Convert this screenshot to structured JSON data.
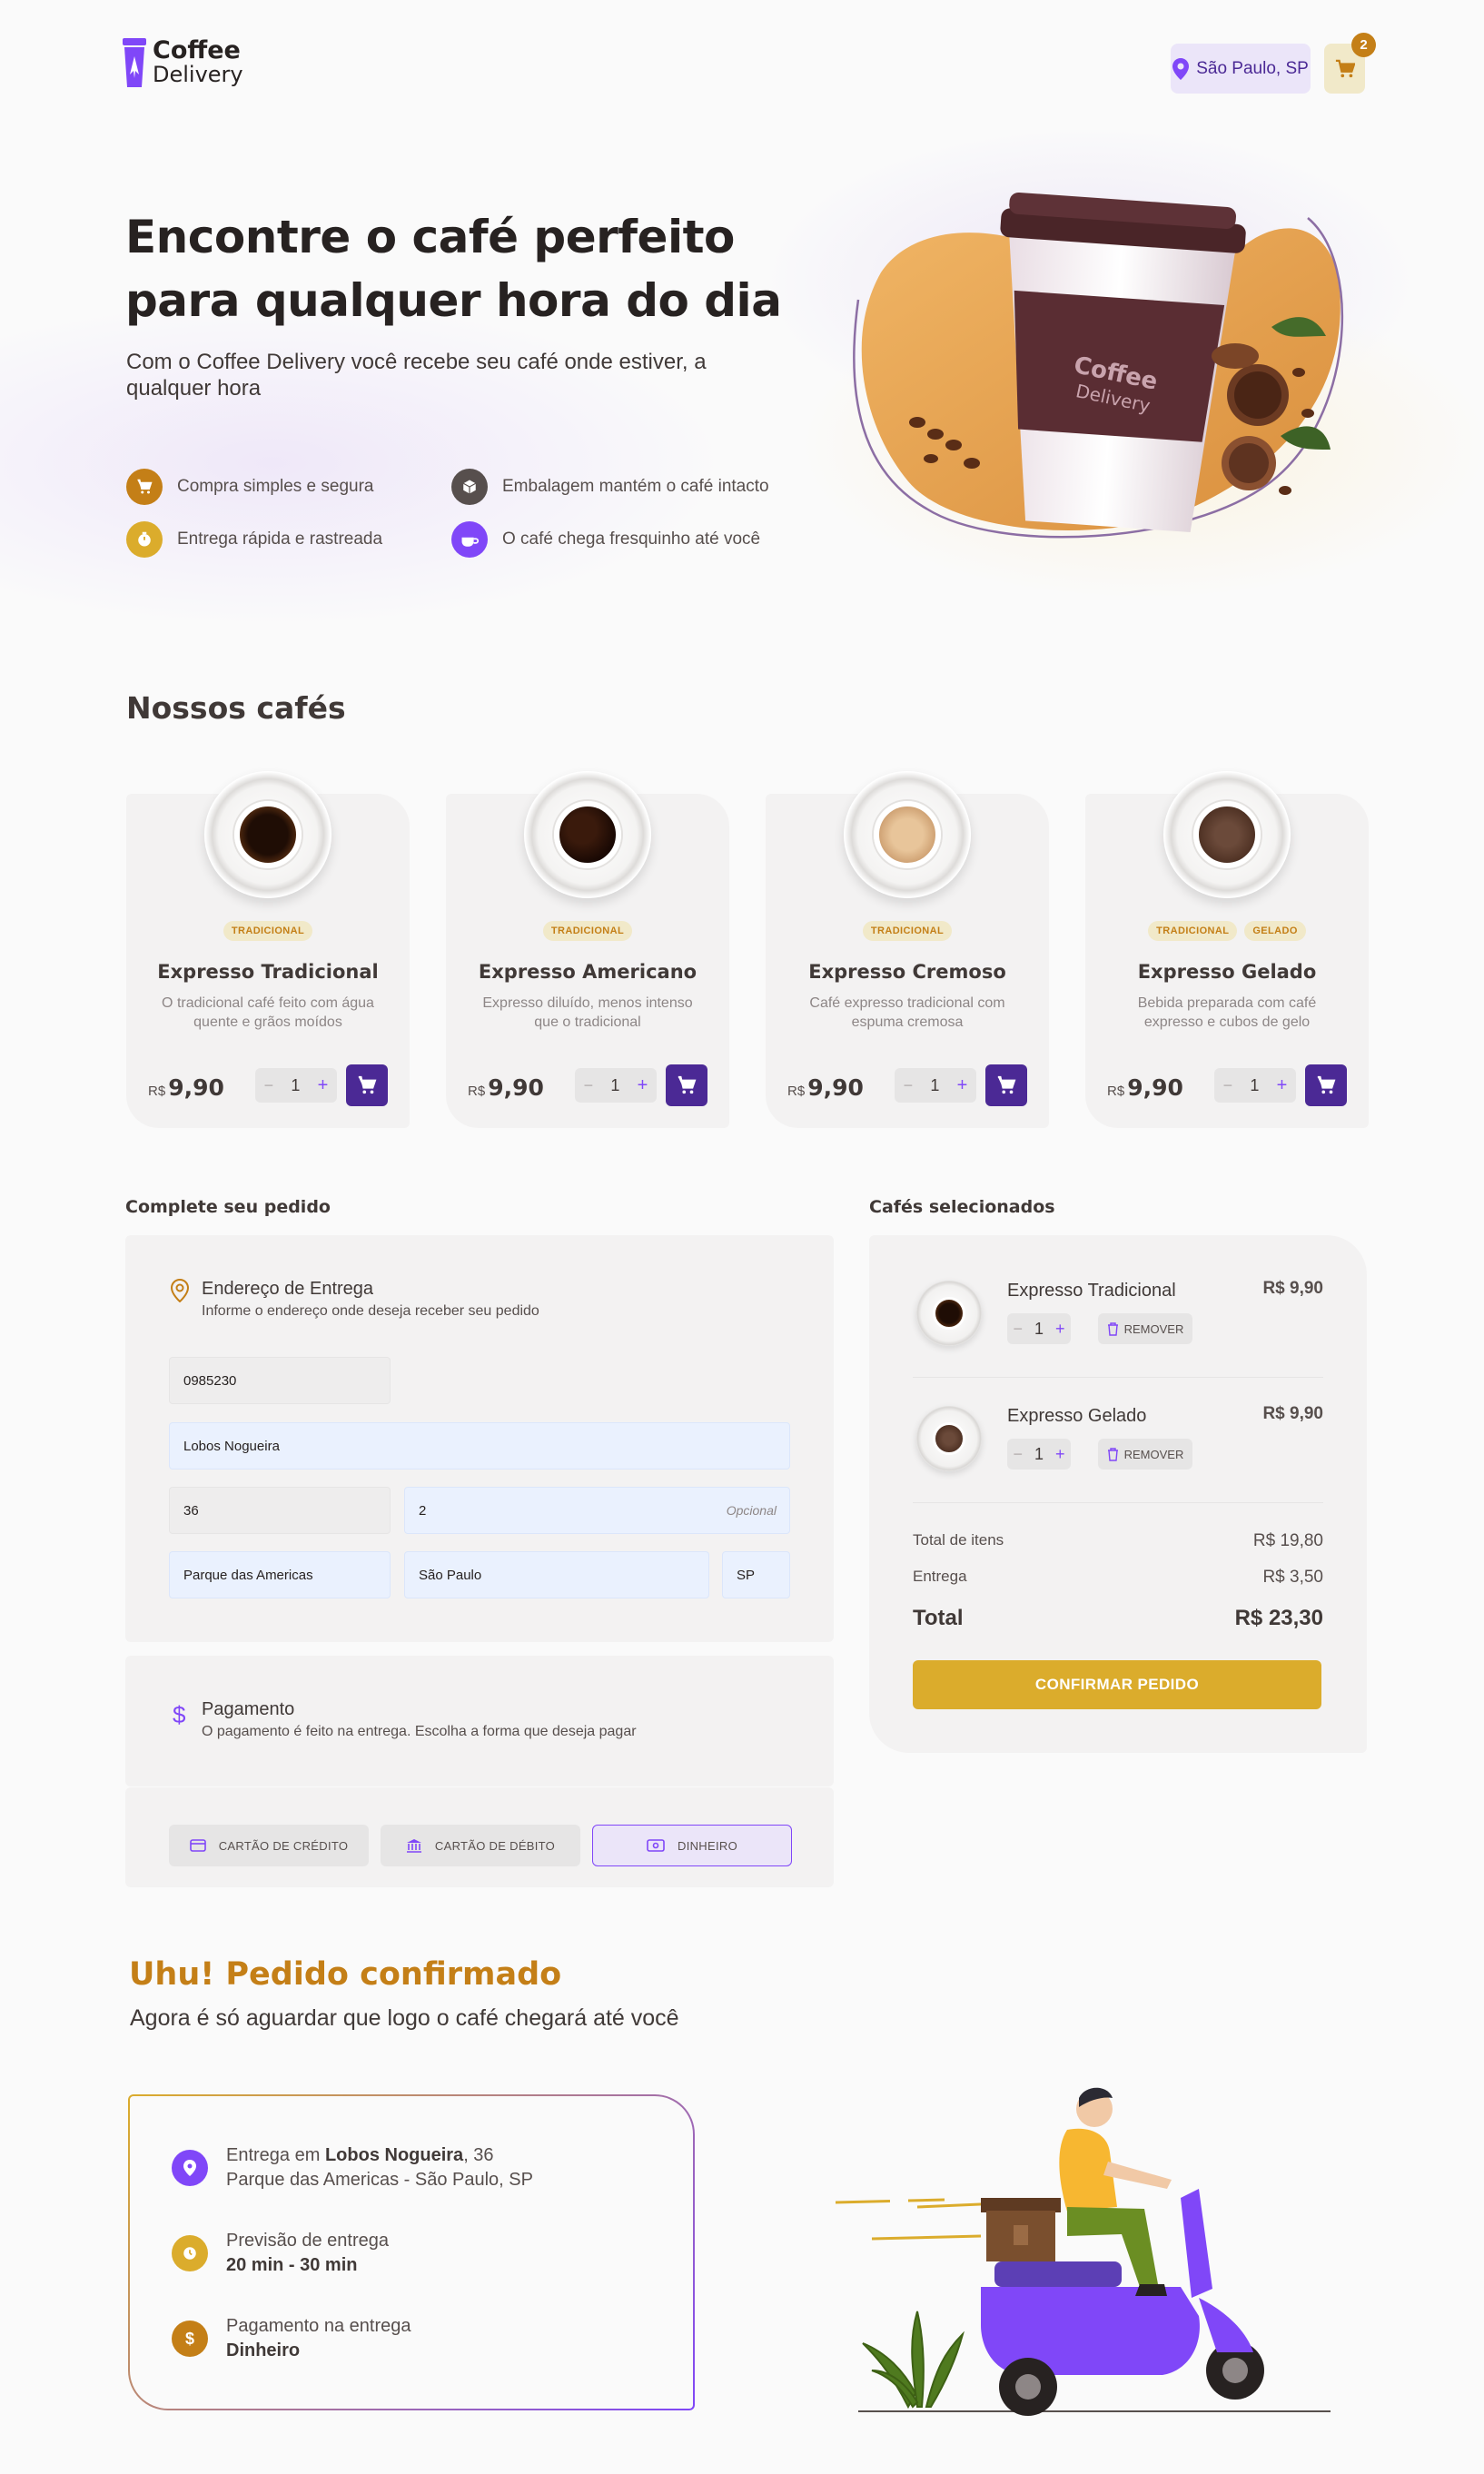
{
  "header": {
    "logo_line1": "Coffee",
    "logo_line2": "Delivery",
    "location": "São Paulo, SP",
    "cart_count": "2"
  },
  "hero": {
    "title": "Encontre o café perfeito para qualquer hora do dia",
    "subtitle": "Com o Coffee Delivery você recebe seu café onde estiver, a qualquer hora",
    "features": [
      {
        "label": "Compra simples e segura",
        "icon": "cart-icon",
        "color": "#c47f17"
      },
      {
        "label": "Embalagem mantém o café intacto",
        "icon": "package-icon",
        "color": "#574f4d"
      },
      {
        "label": "Entrega rápida e rastreada",
        "icon": "timer-icon",
        "color": "#dbac2c"
      },
      {
        "label": "O café chega fresquinho até você",
        "icon": "coffee-icon",
        "color": "#8047f8"
      }
    ],
    "image_brand_line1": "Coffee",
    "image_brand_line2": "Delivery"
  },
  "catalog": {
    "title": "Nossos cafés",
    "items": [
      {
        "tags": [
          "TRADICIONAL"
        ],
        "name": "Expresso Tradicional",
        "description": "O tradicional café feito com água quente e grãos moídos",
        "currency": "R$",
        "price": "9,90",
        "qty": "1"
      },
      {
        "tags": [
          "TRADICIONAL"
        ],
        "name": "Expresso Americano",
        "description": "Expresso diluído, menos intenso que o tradicional",
        "currency": "R$",
        "price": "9,90",
        "qty": "1"
      },
      {
        "tags": [
          "TRADICIONAL"
        ],
        "name": "Expresso Cremoso",
        "description": "Café expresso tradicional com espuma cremosa",
        "currency": "R$",
        "price": "9,90",
        "qty": "1"
      },
      {
        "tags": [
          "TRADICIONAL",
          "GELADO"
        ],
        "name": "Expresso Gelado",
        "description": "Bebida preparada com café expresso e cubos de gelo",
        "currency": "R$",
        "price": "9,90",
        "qty": "1"
      }
    ]
  },
  "order": {
    "title": "Complete seu pedido",
    "address": {
      "title": "Endereço de Entrega",
      "subtitle": "Informe o endereço onde deseja receber seu pedido",
      "cep": "0985230",
      "street": "Lobos Nogueira",
      "number": "36",
      "complement": "2",
      "complement_hint": "Opcional",
      "district": "Parque das Americas",
      "city": "São Paulo",
      "uf": "SP"
    },
    "payment": {
      "title": "Pagamento",
      "subtitle": "O pagamento é feito na entrega. Escolha a forma que deseja pagar",
      "options": [
        "CARTÃO DE CRÉDITO",
        "CARTÃO DE DÉBITO",
        "DINHEIRO"
      ],
      "selected": "DINHEIRO"
    }
  },
  "cart": {
    "title": "Cafés selecionados",
    "items": [
      {
        "name": "Expresso Tradicional",
        "price": "R$ 9,90",
        "qty": "1",
        "remove": "REMOVER"
      },
      {
        "name": "Expresso Gelado",
        "price": "R$ 9,90",
        "qty": "1",
        "remove": "REMOVER"
      }
    ],
    "items_total_label": "Total de itens",
    "items_total": "R$ 19,80",
    "delivery_label": "Entrega",
    "delivery": "R$ 3,50",
    "total_label": "Total",
    "total": "R$ 23,30",
    "confirm_label": "CONFIRMAR PEDIDO"
  },
  "success": {
    "title": "Uhu! Pedido confirmado",
    "subtitle": "Agora é só aguardar que logo o café chegará até você",
    "delivery_prefix": "Entrega em ",
    "delivery_street": "Lobos Nogueira",
    "delivery_number": ", 36",
    "delivery_line2": "Parque das Americas - São Paulo, SP",
    "eta_label": "Previsão de entrega",
    "eta_value": "20 min - 30 min",
    "payment_label": "Pagamento na entrega",
    "payment_value": "Dinheiro"
  },
  "colors": {
    "purple": "#8047f8",
    "purple_dark": "#4b2995",
    "yellow": "#dbac2c",
    "yellow_dark": "#c47f17"
  }
}
